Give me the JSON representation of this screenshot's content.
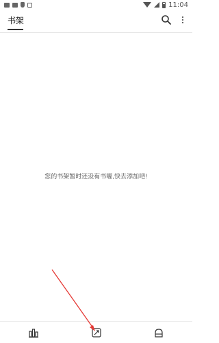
{
  "status_bar": {
    "time": "11:04",
    "icons": [
      "mail-icon",
      "mail-icon",
      "shield-icon",
      "a-icon",
      "wifi-icon",
      "signal-icon",
      "battery-icon"
    ]
  },
  "header": {
    "title": "书架",
    "actions": [
      "search-icon",
      "more-vert-icon"
    ]
  },
  "main": {
    "empty_message": "您的书架暂时还没有书喔,快去添加吧!"
  },
  "bottom_nav": {
    "items": [
      "bookshelf-icon",
      "discover-icon",
      "profile-icon"
    ]
  },
  "colors": {
    "arrow": "#e53935"
  }
}
